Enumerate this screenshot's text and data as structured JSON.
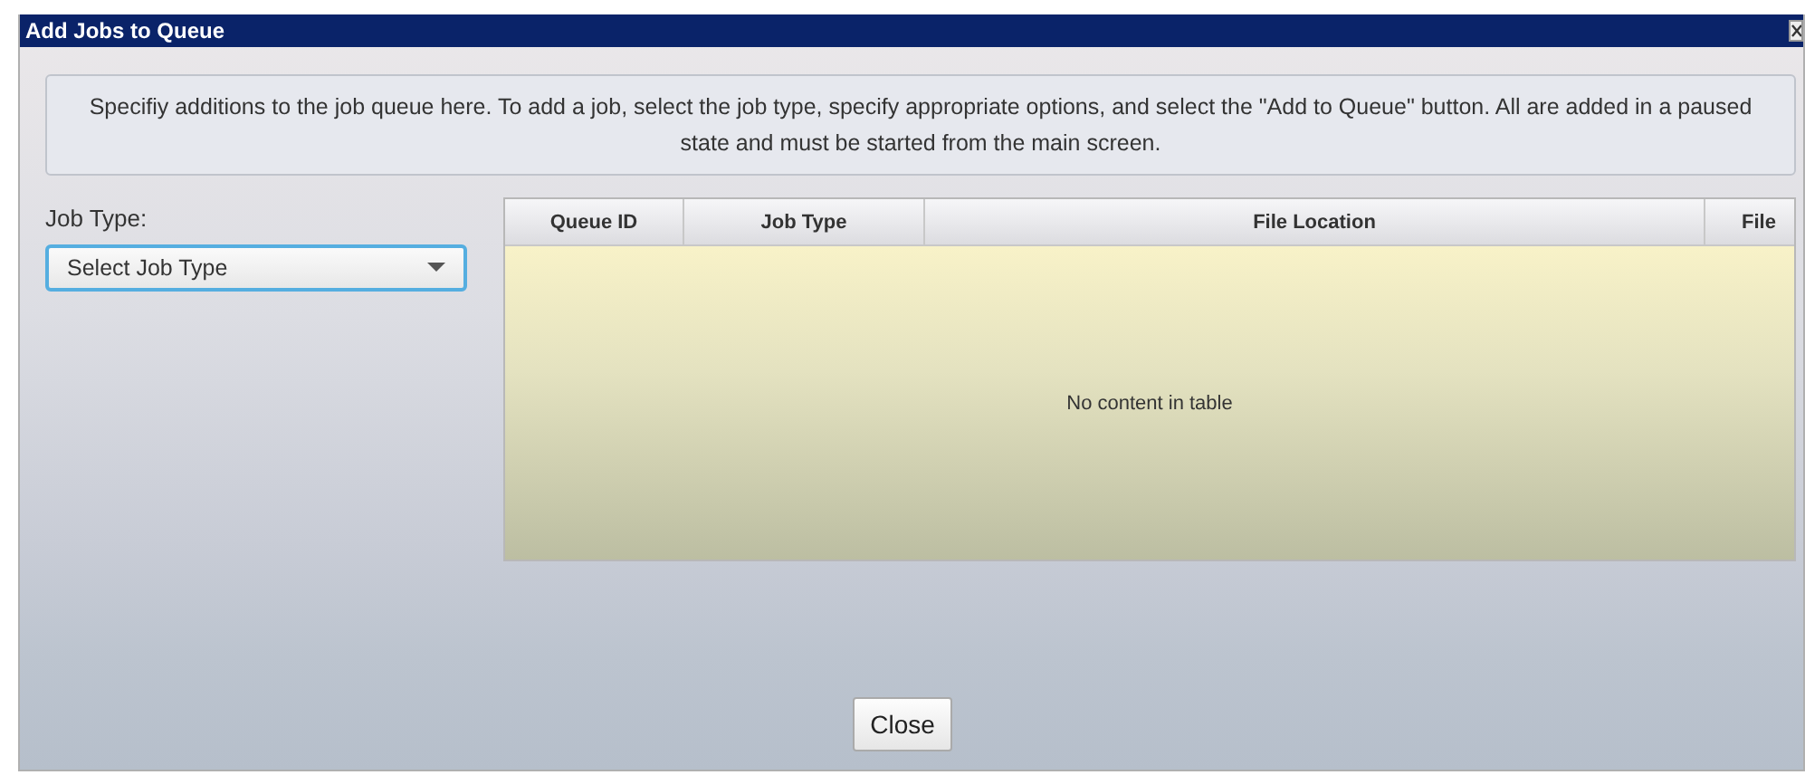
{
  "window": {
    "title": "Add Jobs to Queue"
  },
  "instructions": "Specifiy additions to the job queue here. To add a job, select the job type, specify appropriate options, and select the \"Add to Queue\" button. All are added in a paused state and must be started from the main screen.",
  "job_type": {
    "label": "Job Type:",
    "value": "Select Job Type"
  },
  "table": {
    "columns": [
      "Queue ID",
      "Job Type",
      "File Location",
      "File"
    ],
    "empty_message": "No content in table"
  },
  "buttons": [
    "Close"
  ]
}
